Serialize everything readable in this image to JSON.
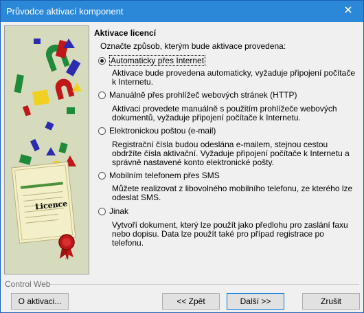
{
  "window": {
    "title": "Průvodce aktivací komponent",
    "close_glyph": "✕"
  },
  "art": {
    "licence_label": "Licence"
  },
  "page": {
    "heading": "Aktivace licencí",
    "intro": "Označte způsob, kterým bude aktivace provedena:",
    "options": [
      {
        "label": "Automaticky přes Internet",
        "selected": true,
        "desc": "Aktivace bude provedena automaticky, vyžaduje připojení počítače k Internetu."
      },
      {
        "label": "Manuálně přes prohlížeč webových stránek (HTTP)",
        "selected": false,
        "desc": "Aktivaci provedete manuálně s použitím prohlížeče webových dokumentů, vyžaduje připojení počítače k Internetu."
      },
      {
        "label": "Elektronickou poštou (e-mail)",
        "selected": false,
        "desc": "Registrační čísla budou odeslána e-mailem, stejnou cestou obdržíte čísla aktivační. Vyžaduje připojení počítače k Internetu a správně nastavené konto elektronické pošty."
      },
      {
        "label": "Mobilním telefonem přes SMS",
        "selected": false,
        "desc": "Můžete realizovat z libovolného mobilního telefonu, ze kterého lze odeslat SMS."
      },
      {
        "label": "Jinak",
        "selected": false,
        "desc": "Vytvoří dokument, který lze použít jako předlohu pro zaslání faxu nebo dopisu. Data lze použít také pro případ registrace po telefonu."
      }
    ]
  },
  "footer": {
    "group_label": "Control Web",
    "about_button": "O aktivaci...",
    "back_button": "<< Zpět",
    "next_button": "Další >>",
    "cancel_button": "Zrušit"
  },
  "colors": {
    "titlebar": "#2b88d8",
    "art_bg": "#d8dcbf",
    "default_button_border": "#0078d7"
  }
}
